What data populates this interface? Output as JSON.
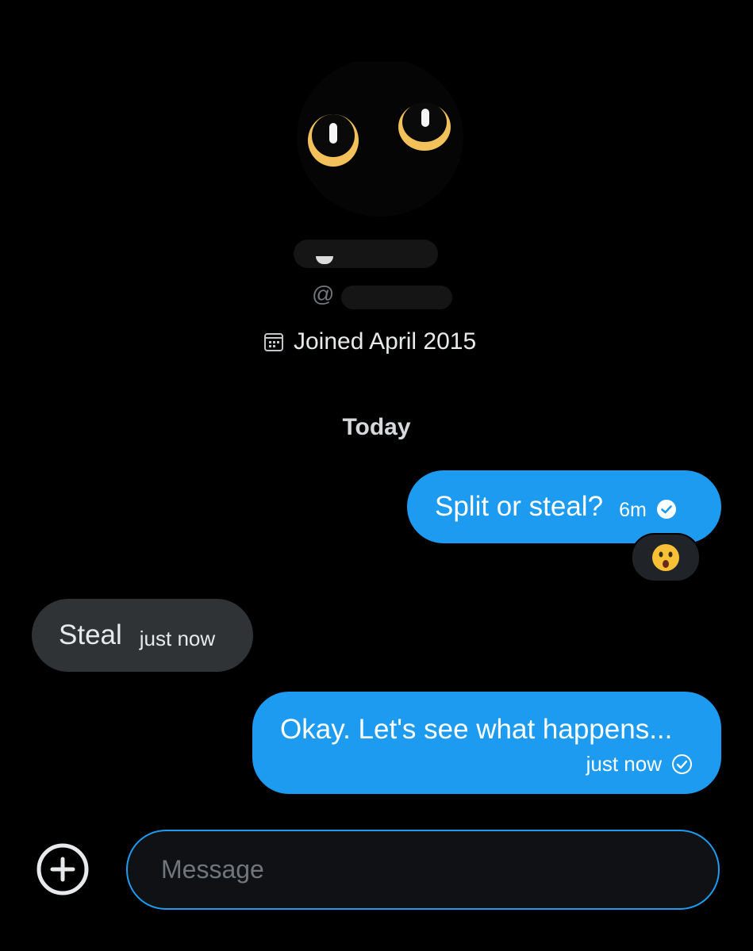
{
  "profile": {
    "handle_prefix": "@",
    "joined": "Joined April 2015",
    "avatar_icon": "cat-eyes-avatar"
  },
  "date_separator": "Today",
  "messages": [
    {
      "direction": "sent",
      "text": "Split or steal?",
      "time": "6m",
      "status": "read",
      "reaction": "astonished-face-emoji"
    },
    {
      "direction": "received",
      "text": "Steal",
      "time": "just now"
    },
    {
      "direction": "sent",
      "text": "Okay. Let's see what happens...",
      "time": "just now",
      "status": "sent"
    }
  ],
  "composer": {
    "placeholder": "Message",
    "add_icon": "plus-circle-icon"
  },
  "colors": {
    "background": "#000000",
    "sent_bubble": "#1d9bf0",
    "received_bubble": "#2f3336",
    "accent": "#1d9bf0"
  }
}
